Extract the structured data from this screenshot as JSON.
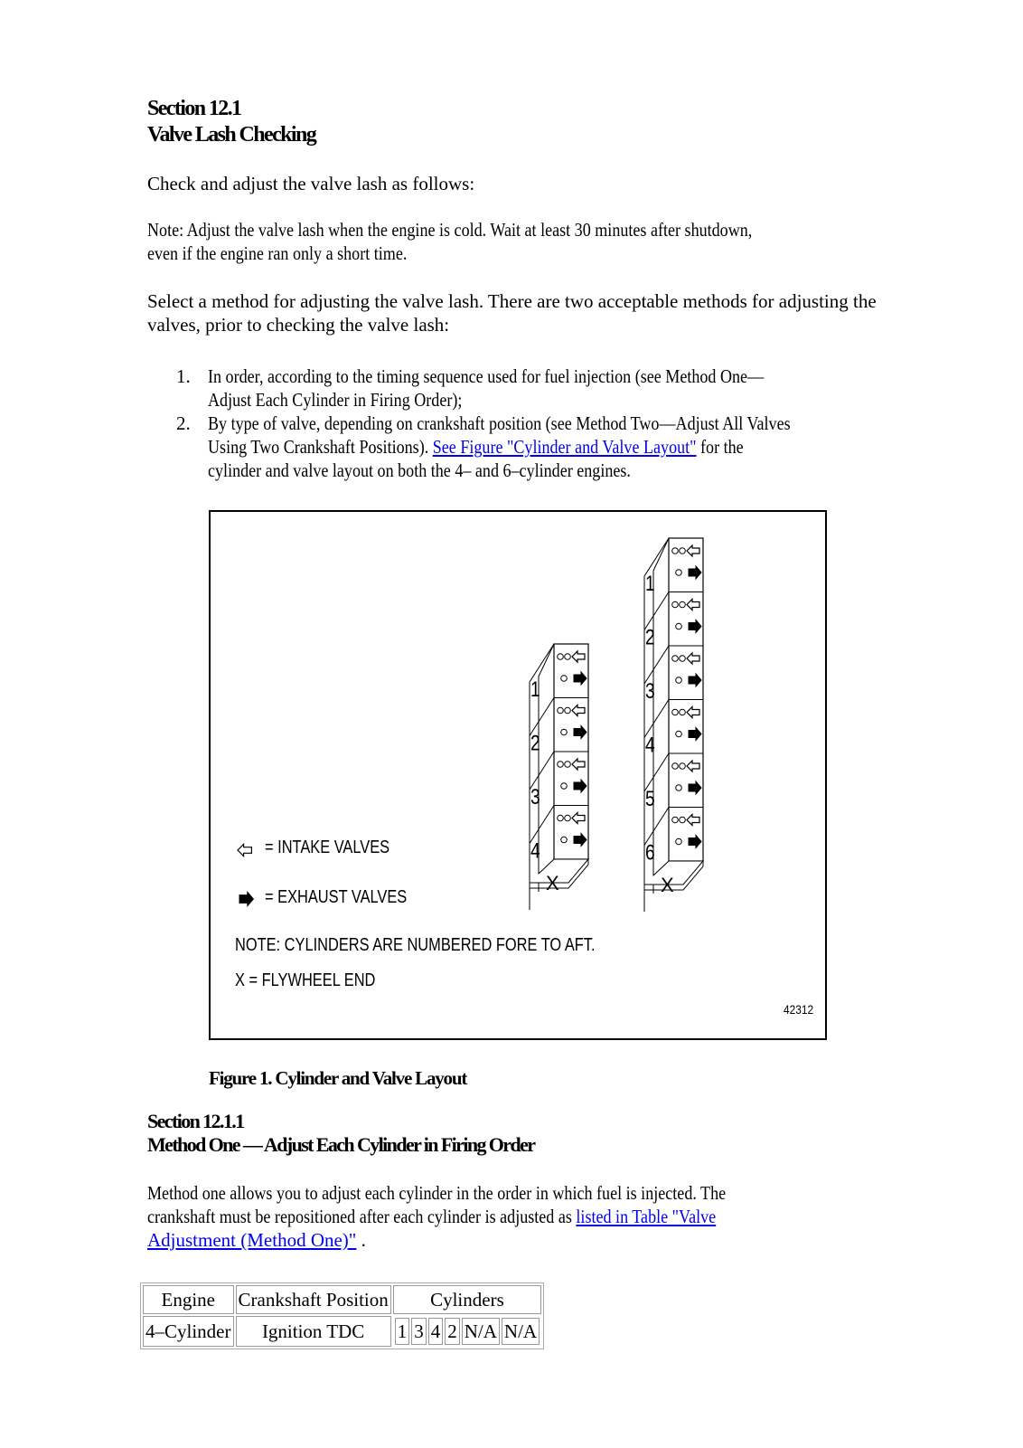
{
  "section": {
    "number": "Section 12.1",
    "title": "Valve Lash Checking"
  },
  "intro": "Check and adjust the valve lash as follows:",
  "note": {
    "line1": "Note: Adjust the valve lash when the engine is cold. Wait at least 30 minutes after shutdown,",
    "line2": "even if the engine ran only a short time."
  },
  "select_method": {
    "line1": "Select a method for adjusting the valve lash. There are two acceptable methods for adjusting the",
    "line2": "valves, prior to checking the valve lash:"
  },
  "methods": [
    {
      "number": "1.",
      "line1": "In order, according to the timing sequence used for fuel injection (see Method One—",
      "line2": "Adjust Each Cylinder in Firing Order);"
    },
    {
      "number": "2.",
      "line1": "By type of valve, depending on crankshaft position (see Method Two—Adjust All Valves",
      "line2_pre": "Using Two Crankshaft Positions). ",
      "link": "See Figure \"Cylinder and Valve Layout\"",
      "line2_post": " for the",
      "line3": "cylinder and valve layout on both the 4– and 6–cylinder engines."
    }
  ],
  "figure": {
    "legend_intake": "= INTAKE VALVES",
    "legend_exhaust": "= EXHAUST VALVES",
    "note": "NOTE: CYLINDERS ARE NUMBERED FORE TO AFT.",
    "flywheel": "X = FLYWHEEL END",
    "flywheel_mark": "X",
    "figure_id": "42312",
    "engine4_cylinders": [
      "1",
      "2",
      "3",
      "4"
    ],
    "engine6_cylinders": [
      "1",
      "2",
      "3",
      "4",
      "5",
      "6"
    ],
    "caption": "Figure 1. Cylinder and Valve Layout"
  },
  "subsection": {
    "number": "Section 12.1.1",
    "title": "Method One — Adjust Each Cylinder in Firing Order"
  },
  "method_one": {
    "line1": "Method one allows you to adjust each cylinder in the order in which fuel is injected. The",
    "line2_pre": "crankshaft must be repositioned after each cylinder is adjusted as ",
    "link_part1": "listed in Table \"Valve",
    "link_part2": "Adjustment (Method One)\"",
    "line3_post": " ."
  },
  "table": {
    "headers": [
      "Engine",
      "Crankshaft Position",
      "Cylinders"
    ],
    "rows": [
      {
        "engine": "4–Cylinder",
        "position": "Ignition TDC",
        "cylinders": [
          "1",
          "3",
          "4",
          "2",
          "N/A",
          "N/A"
        ]
      }
    ]
  }
}
